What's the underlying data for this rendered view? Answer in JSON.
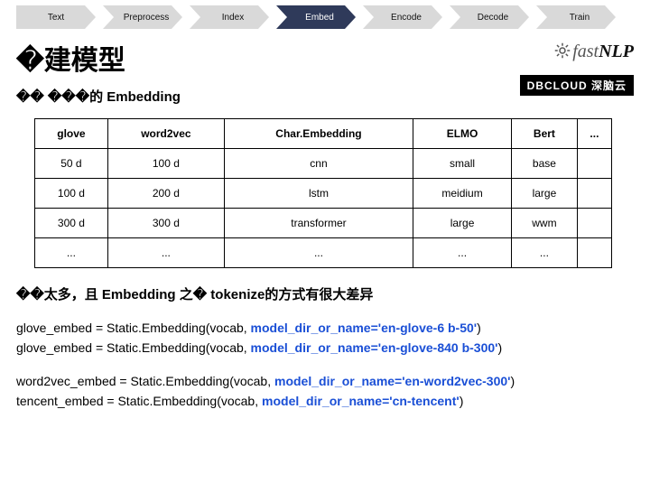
{
  "nav": [
    "Text",
    "Preprocess",
    "Index",
    "Embed",
    "Encode",
    "Decode",
    "Train"
  ],
  "nav_active_index": 3,
  "title": "�建模型",
  "subtitle": "�� ���的 Embedding",
  "brand": {
    "fast": "fast",
    "nlp": "NLP",
    "dbcloud": "DBCLOUD 深脑云"
  },
  "table": {
    "headers": [
      "glove",
      "word2vec",
      "Char.Embedding",
      "ELMO",
      "Bert",
      "..."
    ],
    "rows": [
      [
        "50 d",
        "100 d",
        "cnn",
        "small",
        "base",
        ""
      ],
      [
        "100 d",
        "200 d",
        "lstm",
        "meidium",
        "large",
        ""
      ],
      [
        "300 d",
        "300 d",
        "transformer",
        "large",
        "wwm",
        ""
      ],
      [
        "...",
        "...",
        "...",
        "...",
        "...",
        ""
      ]
    ]
  },
  "note": "��太多，且 Embedding 之� tokenize的方式有很大差异",
  "code": [
    [
      {
        "t": "glove_embed = Static.Embedding(vocab, ",
        "c": "black"
      },
      {
        "t": "model_dir_or_name='en-glove-6 b-50'",
        "c": "blue"
      },
      {
        "t": ")",
        "c": "black"
      }
    ],
    [
      {
        "t": "glove_embed = Static.Embedding(vocab, ",
        "c": "black"
      },
      {
        "t": "model_dir_or_name='en-glove-840 b-300'",
        "c": "blue"
      },
      {
        "t": ")",
        "c": "black"
      }
    ],
    [
      {
        "t": "word2vec_embed = Static.Embedding(vocab, ",
        "c": "black"
      },
      {
        "t": "model_dir_or_name='en-word2vec-300'",
        "c": "blue"
      },
      {
        "t": ")",
        "c": "black"
      }
    ],
    [
      {
        "t": "tencent_embed = Static.Embedding(vocab, ",
        "c": "black"
      },
      {
        "t": "model_dir_or_name='cn-tencent'",
        "c": "blue"
      },
      {
        "t": ")",
        "c": "black"
      }
    ]
  ],
  "code_groups": [
    [
      0,
      1
    ],
    [
      2,
      3
    ]
  ]
}
